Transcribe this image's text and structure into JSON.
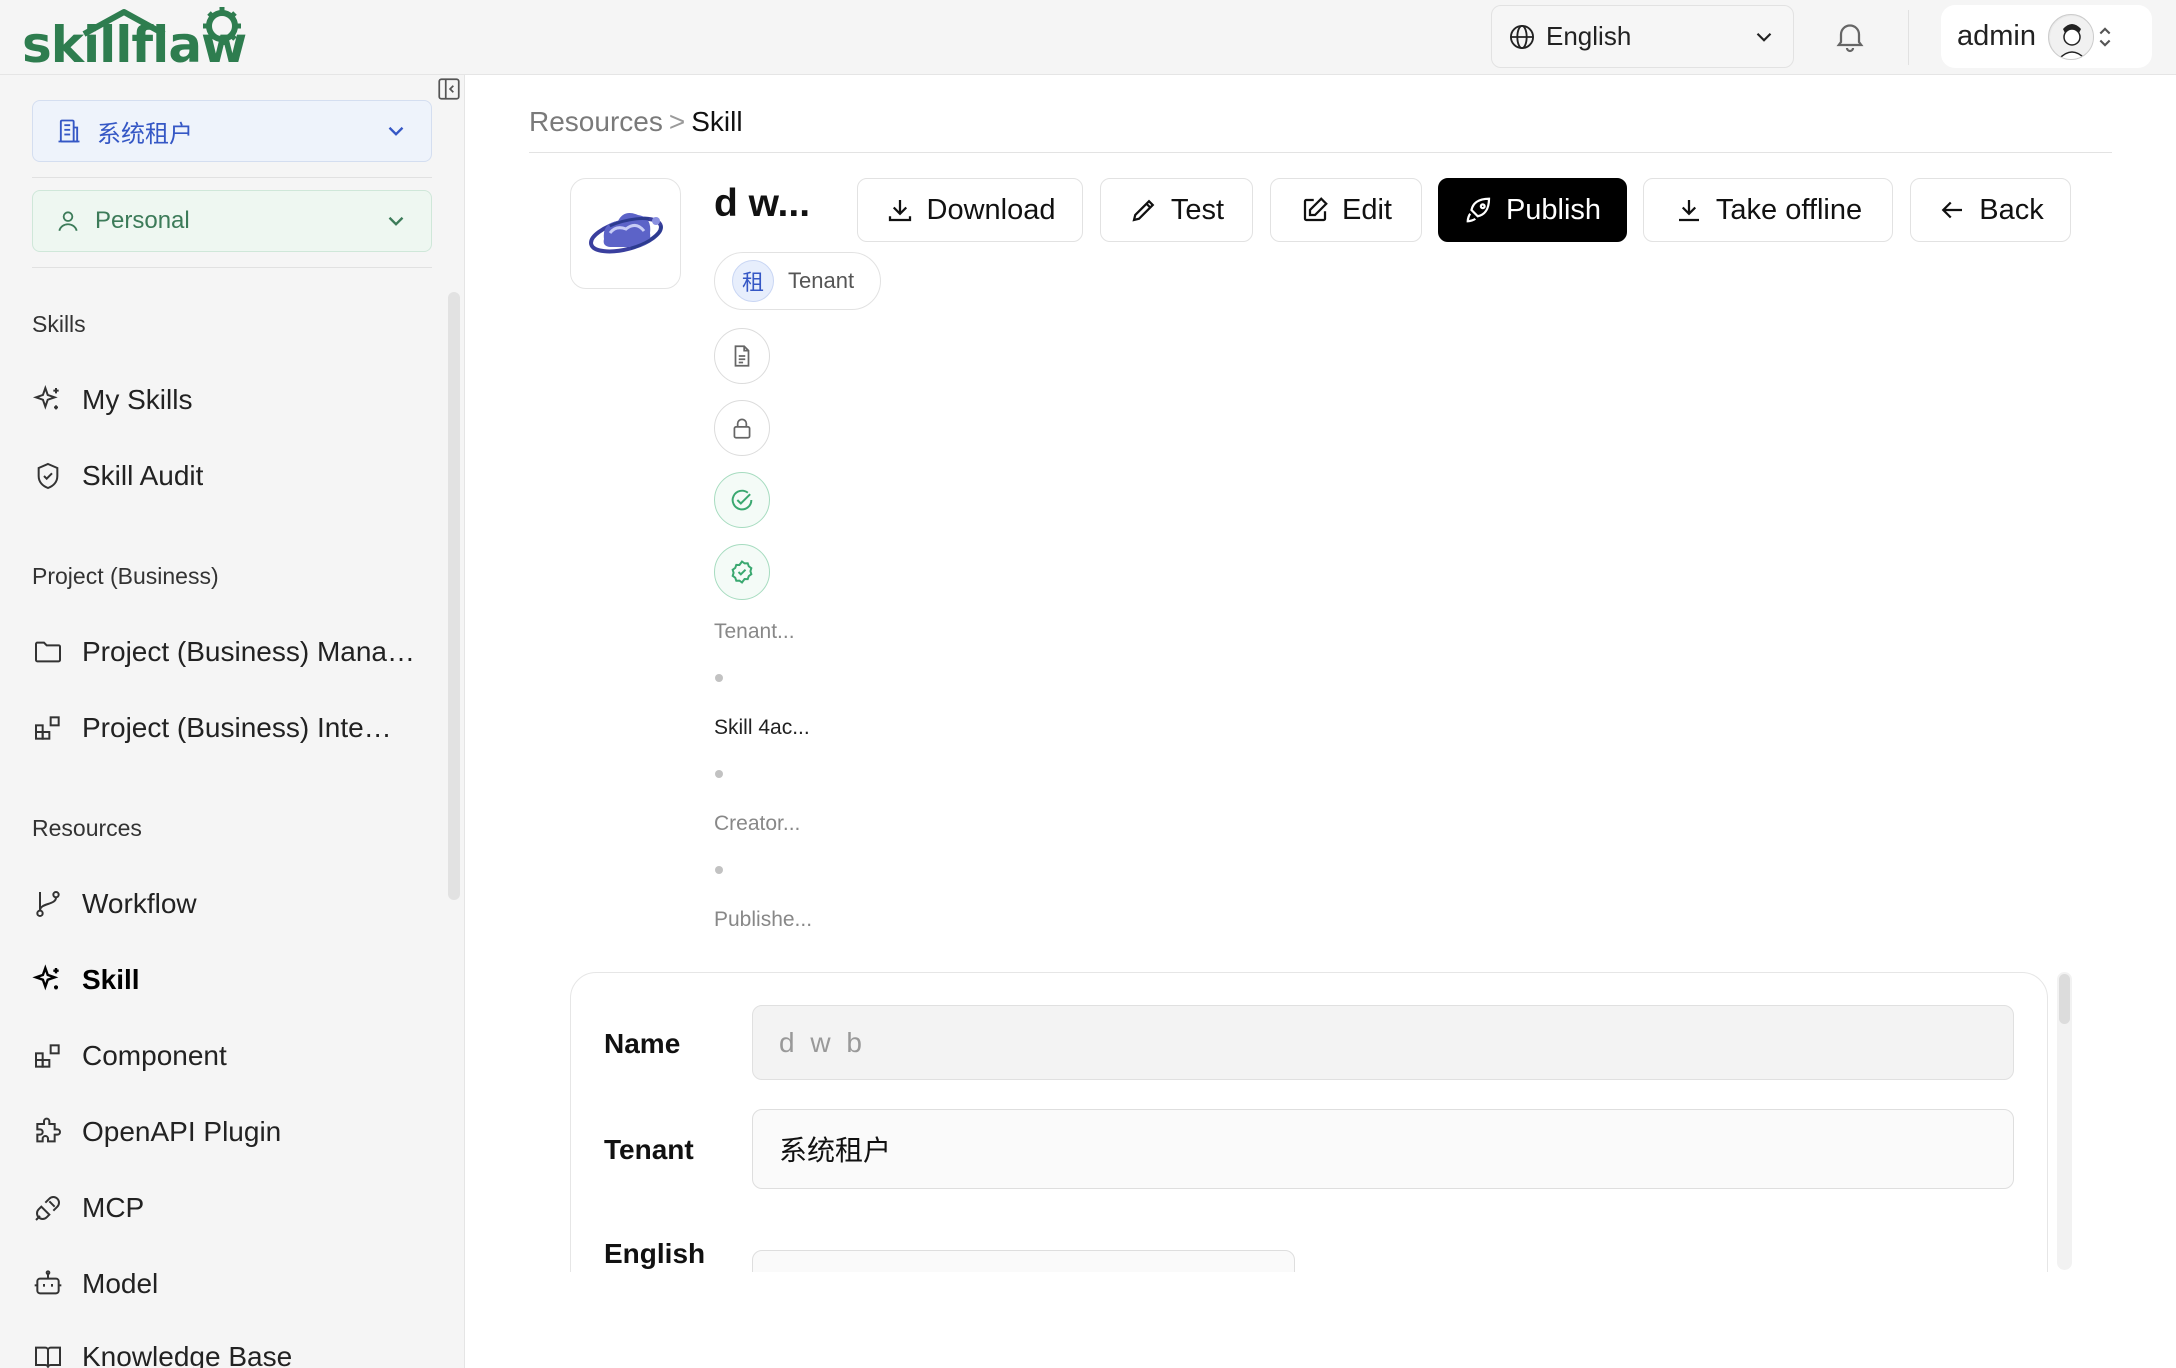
{
  "header": {
    "logo_text": "skillflaw",
    "language": "English",
    "user_name": "admin"
  },
  "sidebar": {
    "tenant_select": "系统租户",
    "personal_select": "Personal",
    "sections": {
      "skills": "Skills",
      "project": "Project (Business)",
      "resources": "Resources"
    },
    "items": {
      "my_skills": "My Skills",
      "skill_audit": "Skill Audit",
      "project_man": "Project (Business) Management",
      "project_inte": "Project (Business) Integration",
      "workflow": "Workflow",
      "skill": "Skill",
      "component": "Component",
      "openapi": "OpenAPI Plugin",
      "mcp": "MCP",
      "model": "Model",
      "knowledge": "Knowledge Base"
    }
  },
  "breadcrumb": {
    "parent": "Resources",
    "separator": ">",
    "current": "Skill"
  },
  "skill": {
    "name": "d w...",
    "tenant_badge": "租",
    "tenant_label": "Tenant",
    "meta_tenant": "Tenant...",
    "meta_skill": "Skill 4ac...",
    "meta_creator": "Creator...",
    "meta_published": "Publishe..."
  },
  "actions": {
    "download": "Download",
    "test": "Test",
    "edit": "Edit",
    "publish": "Publish",
    "take_offline": "Take offline",
    "back": "Back"
  },
  "form": {
    "name_label": "Name",
    "name_value": "d w b",
    "tenant_label": "Tenant",
    "tenant_value": "系统租户",
    "english_label": "English"
  },
  "colors": {
    "brand_green": "#2e7d4f",
    "tenant_blue": "#3557c5",
    "primary_black": "#000000"
  }
}
